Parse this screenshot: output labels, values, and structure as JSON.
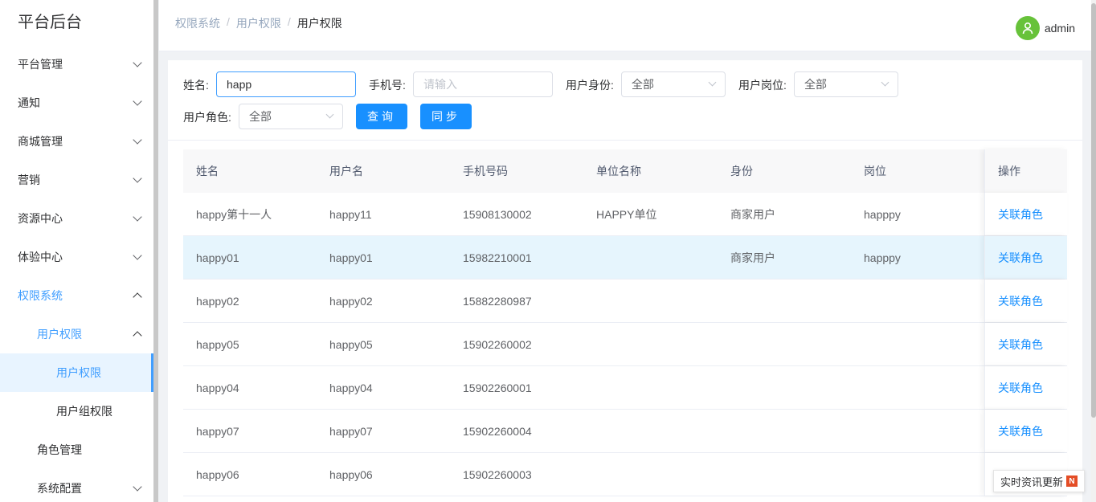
{
  "sidebar": {
    "title": "平台后台",
    "items": [
      {
        "label": "平台管理"
      },
      {
        "label": "通知"
      },
      {
        "label": "商城管理"
      },
      {
        "label": "营销"
      },
      {
        "label": "资源中心"
      },
      {
        "label": "体验中心"
      },
      {
        "label": "权限系统"
      },
      {
        "label": "用户权限"
      },
      {
        "label": "用户权限"
      },
      {
        "label": "用户组权限"
      },
      {
        "label": "角色管理"
      },
      {
        "label": "系统配置"
      }
    ]
  },
  "header": {
    "breadcrumb": [
      "权限系统",
      "用户权限",
      "用户权限"
    ],
    "separator": "/",
    "username": "admin"
  },
  "filters": {
    "name_label": "姓名:",
    "name_value": "happ",
    "phone_label": "手机号:",
    "phone_placeholder": "请输入",
    "identity_label": "用户身份:",
    "identity_value": "全部",
    "post_label": "用户岗位:",
    "post_value": "全部",
    "role_label": "用户角色:",
    "role_value": "全部",
    "query_button": "查询",
    "sync_button": "同步"
  },
  "table": {
    "columns": [
      "姓名",
      "用户名",
      "手机号码",
      "单位名称",
      "身份",
      "岗位",
      "操作"
    ],
    "rows": [
      {
        "name": "happy第十一人",
        "username": "happy11",
        "phone": "15908130002",
        "unit": "HAPPY单位",
        "identity": "商家用户",
        "post": "happpy",
        "action": "关联角色"
      },
      {
        "name": "happy01",
        "username": "happy01",
        "phone": "15982210001",
        "unit": "",
        "identity": "商家用户",
        "post": "happpy",
        "action": "关联角色"
      },
      {
        "name": "happy02",
        "username": "happy02",
        "phone": "15882280987",
        "unit": "",
        "identity": "",
        "post": "",
        "action": "关联角色"
      },
      {
        "name": "happy05",
        "username": "happy05",
        "phone": "15902260002",
        "unit": "",
        "identity": "",
        "post": "",
        "action": "关联角色"
      },
      {
        "name": "happy04",
        "username": "happy04",
        "phone": "15902260001",
        "unit": "",
        "identity": "",
        "post": "",
        "action": "关联角色"
      },
      {
        "name": "happy07",
        "username": "happy07",
        "phone": "15902260004",
        "unit": "",
        "identity": "",
        "post": "",
        "action": "关联角色"
      },
      {
        "name": "happy06",
        "username": "happy06",
        "phone": "15902260003",
        "unit": "",
        "identity": "",
        "post": "",
        "action": ""
      }
    ]
  },
  "news_widget": {
    "label": "实时资讯更新",
    "badge": "N"
  },
  "colors": {
    "accent": "#1890ff",
    "highlight_row": "#e6f5fd",
    "avatar": "#67c23a"
  }
}
